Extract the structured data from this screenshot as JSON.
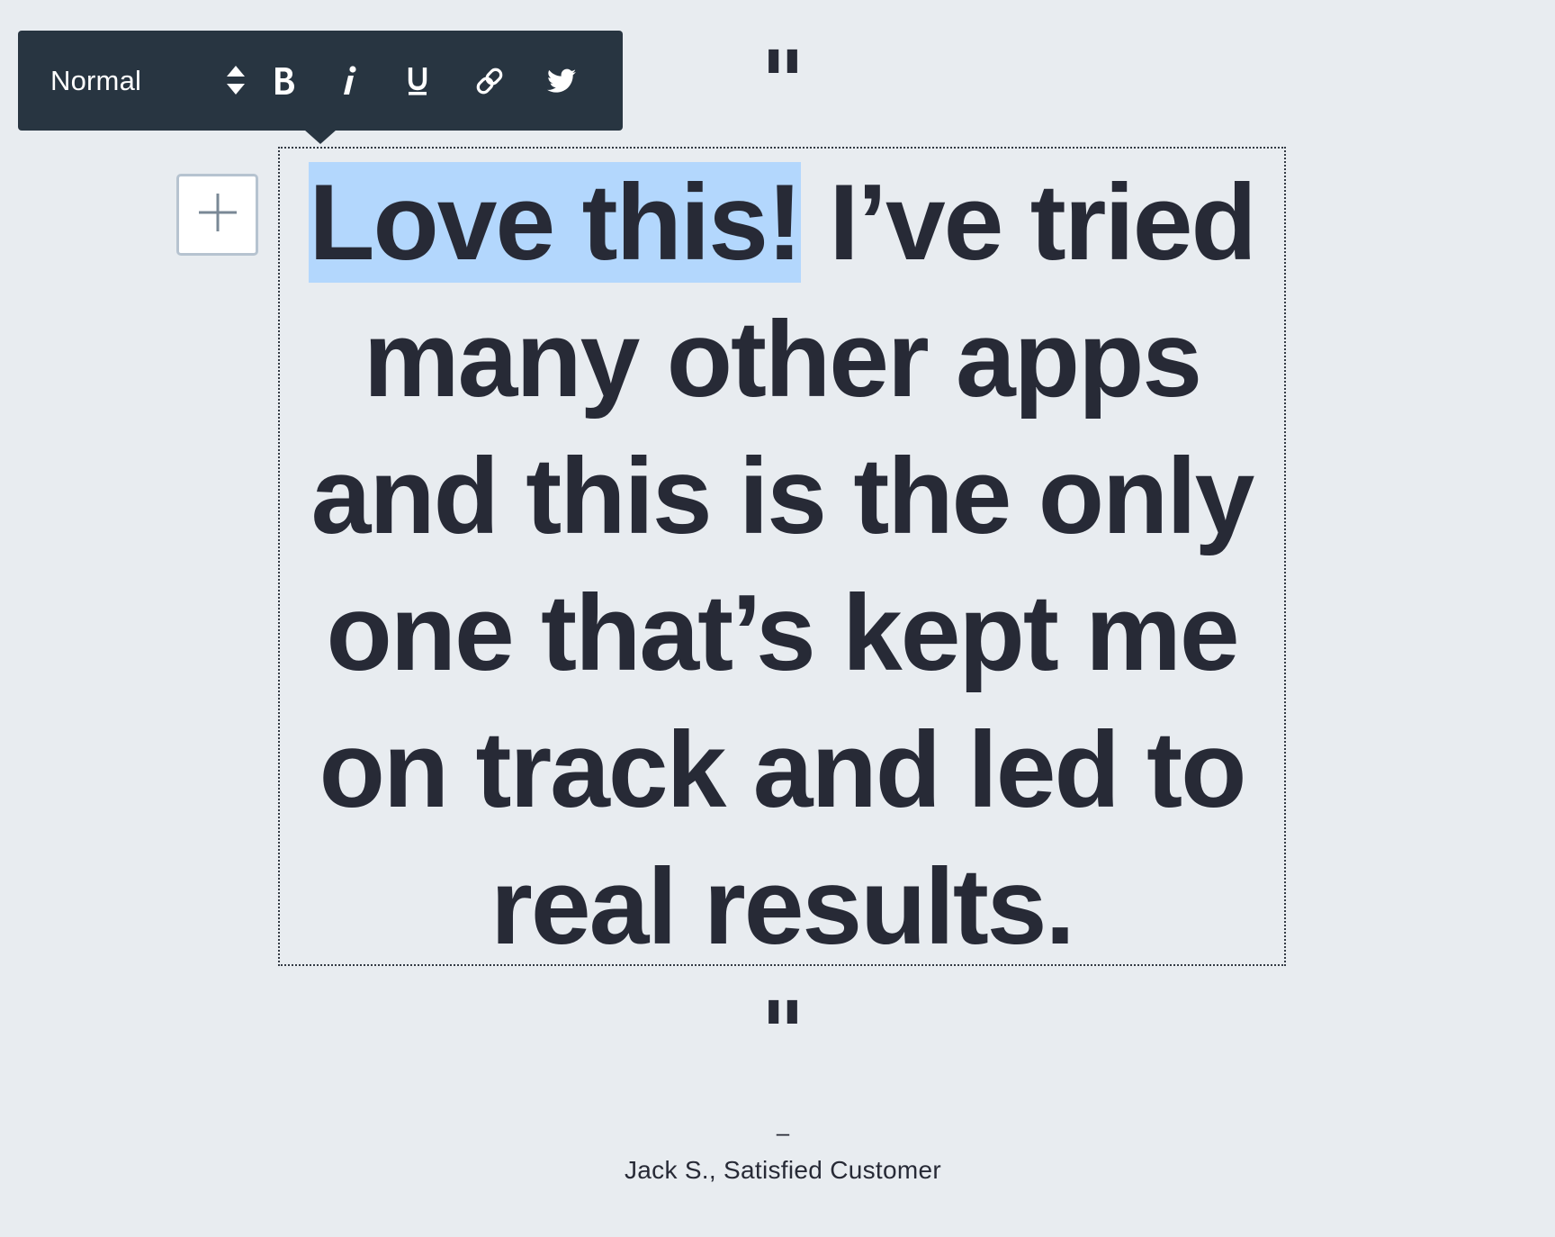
{
  "toolbar": {
    "format_select": "Normal",
    "buttons": [
      {
        "name": "bold",
        "icon": "bold-icon"
      },
      {
        "name": "italic",
        "icon": "italic-icon"
      },
      {
        "name": "underline",
        "icon": "underline-icon"
      },
      {
        "name": "link",
        "icon": "link-icon"
      },
      {
        "name": "twitter",
        "icon": "twitter-icon"
      }
    ]
  },
  "add_block": {
    "icon": "plus-icon"
  },
  "quote": {
    "open_mark": "\"",
    "selected_text": "Love this!",
    "rest_text": " I’ve tried many other apps and this is the only one that’s kept me on track and led to real results.",
    "close_mark": "\""
  },
  "attribution": {
    "dash": "–",
    "citation": "Jack S., Satisfied Customer"
  },
  "colors": {
    "background": "#e8ecf0",
    "toolbar": "#283541",
    "text": "#272a36",
    "selection": "#b3d7fd",
    "add_block_border": "#b6c3d0"
  }
}
